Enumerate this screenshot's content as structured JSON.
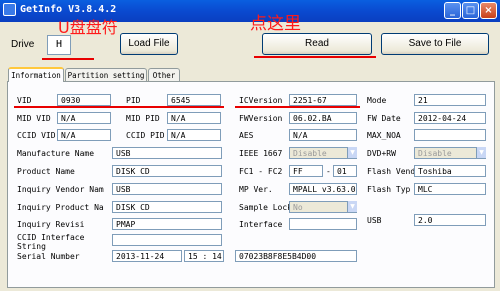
{
  "window": {
    "title": "GetInfo V3.8.4.2"
  },
  "drive": {
    "label": "Drive",
    "value": "H"
  },
  "annotations": {
    "udisk": "U盘盘符",
    "click_here": "点这里"
  },
  "buttons": {
    "load": "Load File",
    "read": "Read",
    "save": "Save to File"
  },
  "tabs": [
    "Information",
    "Partition setting",
    "Other"
  ],
  "fields": {
    "vid": {
      "label": "VID",
      "value": "0930"
    },
    "pid": {
      "label": "PID",
      "value": "6545"
    },
    "icversion": {
      "label": "ICVersion",
      "value": "2251-67"
    },
    "mode": {
      "label": "Mode",
      "value": "21"
    },
    "mid_vid": {
      "label": "MID VID",
      "value": "N/A"
    },
    "mid_pid": {
      "label": "MID PID",
      "value": "N/A"
    },
    "fwversion": {
      "label": "FWVersion",
      "value": "06.02.BA"
    },
    "fw_date": {
      "label": "FW Date",
      "value": "2012-04-24"
    },
    "ccid_vid": {
      "label": "CCID VID",
      "value": "N/A"
    },
    "ccid_pid": {
      "label": "CCID PID",
      "value": "N/A"
    },
    "aes": {
      "label": "AES",
      "value": "N/A"
    },
    "max_noa": {
      "label": "MAX_NOA",
      "value": ""
    },
    "manufacture_name": {
      "label": "Manufacture Name",
      "value": "USB"
    },
    "ieee1667": {
      "label": "IEEE 1667",
      "value": "Disable"
    },
    "dvd_rw": {
      "label": "DVD+RW",
      "value": "Disable"
    },
    "product_name": {
      "label": "Product Name",
      "value": "DISK CD"
    },
    "fc1_fc2": {
      "label": "FC1 - FC2",
      "value1": "FF",
      "sep": "-",
      "value2": "01"
    },
    "flash_vendor": {
      "label": "Flash Vendo",
      "value": "Toshiba"
    },
    "inquiry_vendor": {
      "label": "Inquiry Vendor Nam",
      "value": "USB"
    },
    "mp_ver": {
      "label": "MP Ver.",
      "value": "MPALL v3.63.00"
    },
    "flash_type": {
      "label": "Flash Typ",
      "value": "MLC"
    },
    "inquiry_product": {
      "label": "Inquiry Product Na",
      "value": "DISK CD"
    },
    "sample_lock": {
      "label": "Sample Lock",
      "value": "No"
    },
    "inquiry_revision": {
      "label": "Inquiry Revisi",
      "value": "PMAP"
    },
    "interface": {
      "label": "Interface",
      "value": ""
    },
    "usb": {
      "label": "USB",
      "value": "2.0"
    },
    "ccid_interface": {
      "label": "CCID Interface String",
      "value": ""
    },
    "serial_number": {
      "label": "Serial Number",
      "date": "2013-11-24",
      "time": "15 : 14",
      "value": "07023B8F8E5B4D00"
    }
  }
}
